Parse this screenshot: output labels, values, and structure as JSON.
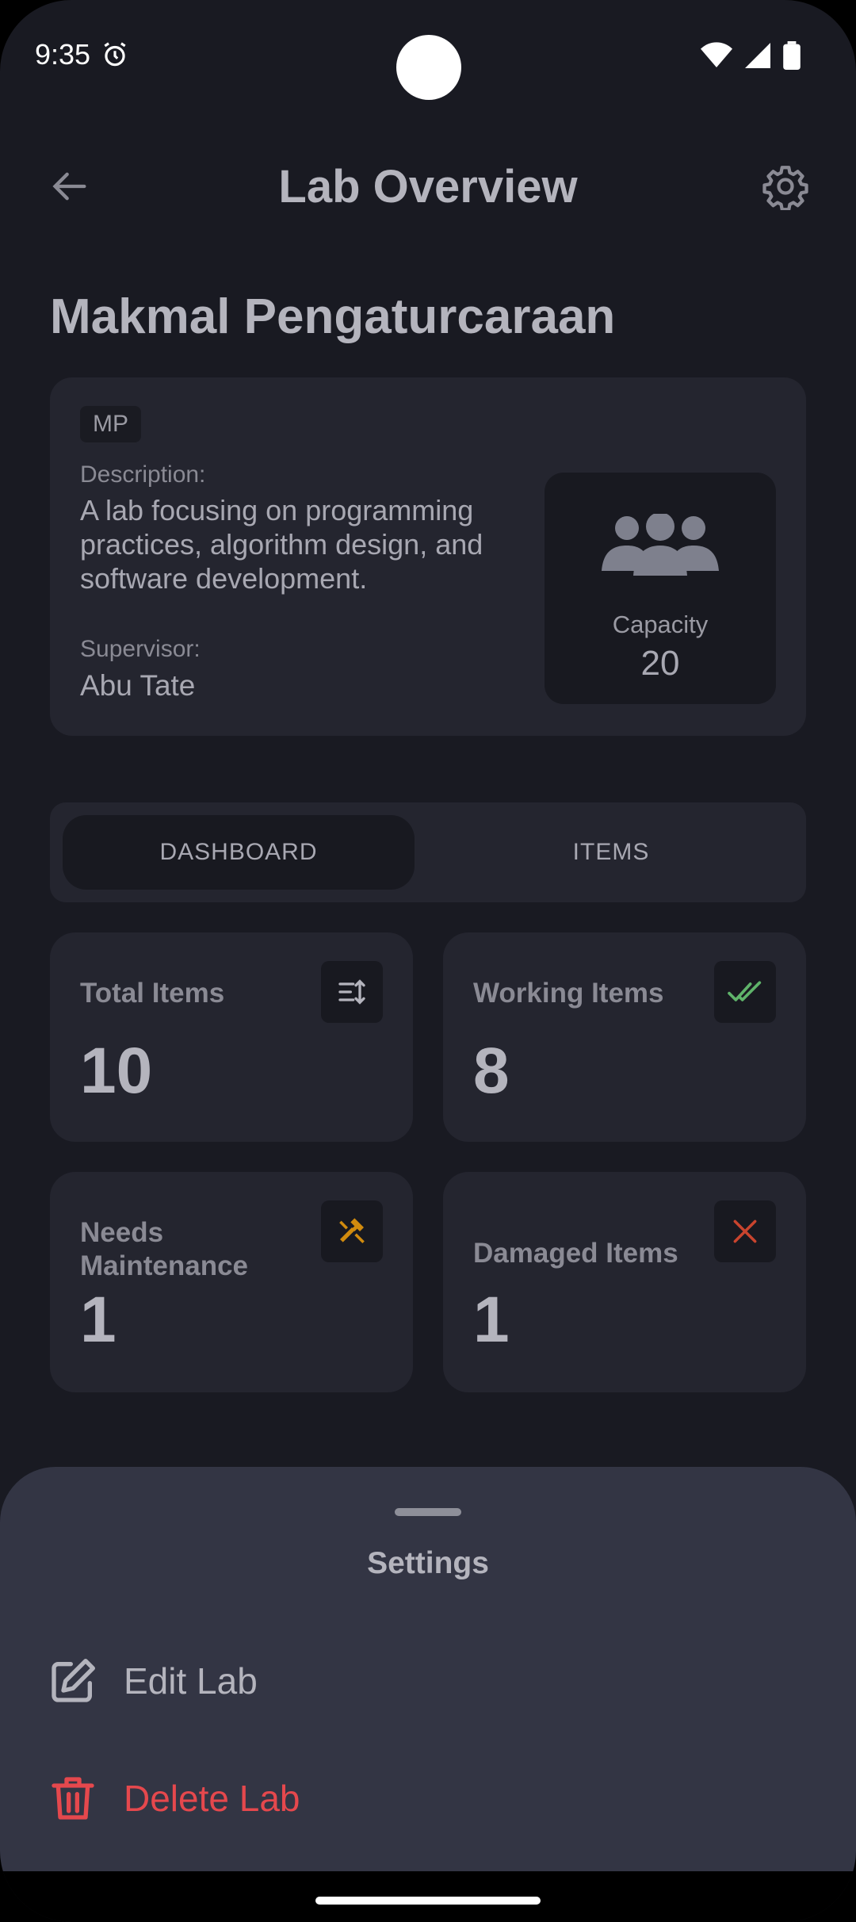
{
  "status_bar": {
    "time": "9:35"
  },
  "app_bar": {
    "title": "Lab Overview"
  },
  "lab": {
    "name": "Makmal Pengaturcaraan",
    "code": "MP",
    "description_label": "Description:",
    "description": "A lab focusing on programming practices, algorithm design, and software development.",
    "supervisor_label": "Supervisor:",
    "supervisor": "Abu Tate",
    "capacity_label": "Capacity",
    "capacity": "20"
  },
  "tabs": [
    {
      "label": "DASHBOARD",
      "active": true
    },
    {
      "label": "ITEMS",
      "active": false
    }
  ],
  "stats": [
    {
      "label": "Total Items",
      "value": "10",
      "icon": "sort-icon",
      "color": "#b4b4bd"
    },
    {
      "label": "Working Items",
      "value": "8",
      "icon": "double-check-icon",
      "color": "#5fb36a"
    },
    {
      "label": "Needs Maintenance",
      "value": "1",
      "icon": "tools-icon",
      "color": "#d18b0e"
    },
    {
      "label": "Damaged Items",
      "value": "1",
      "icon": "close-icon",
      "color": "#c9442e"
    }
  ],
  "sheet": {
    "title": "Settings",
    "items": [
      {
        "label": "Edit Lab",
        "icon": "edit-icon",
        "color": "#b4b4bd"
      },
      {
        "label": "Delete Lab",
        "icon": "trash-icon",
        "color": "#e5484d"
      }
    ]
  }
}
